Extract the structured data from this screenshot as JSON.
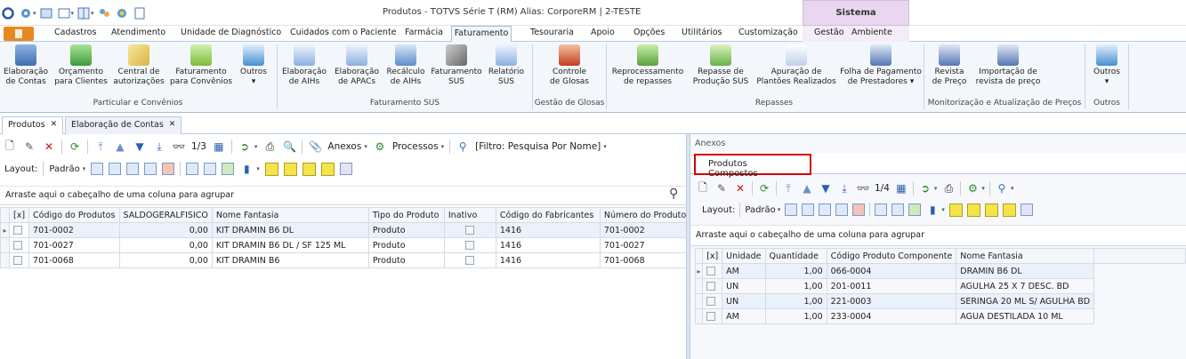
{
  "window_title": "Produtos - TOTVS Série T  (RM) Alias: CorporeRM | 2-TESTE",
  "context_tab": "Sistema",
  "menu_tabs": [
    "Cadastros",
    "Atendimento",
    "Unidade de Diagnóstico",
    "Cuidados com o Paciente",
    "Farmácia",
    "Faturamento",
    "Tesouraria",
    "Apoio",
    "Opções",
    "Utilitários",
    "Customização",
    "Gestão",
    "Ambiente"
  ],
  "active_menu_tab": "Faturamento",
  "ribbon": {
    "buttons": [
      {
        "l1": "Elaboração",
        "l2": "de Contas"
      },
      {
        "l1": "Orçamento",
        "l2": "para Clientes"
      },
      {
        "l1": "Central de",
        "l2": "autorizações"
      },
      {
        "l1": "Faturamento",
        "l2": "para Convênios"
      },
      {
        "l1": "Outros",
        "l2": "▾"
      },
      {
        "l1": "Elaboração",
        "l2": "de AIHs"
      },
      {
        "l1": "Elaboração",
        "l2": "de APACs"
      },
      {
        "l1": "Recálculo",
        "l2": "de AIHs"
      },
      {
        "l1": "Faturamento",
        "l2": "SUS"
      },
      {
        "l1": "Relatório",
        "l2": "SUS"
      },
      {
        "l1": "Controle",
        "l2": "de Glosas"
      },
      {
        "l1": "Reprocessamento",
        "l2": "de repasses"
      },
      {
        "l1": "Repasse de",
        "l2": "Produção SUS"
      },
      {
        "l1": "Apuração de",
        "l2": "Plantões Realizados"
      },
      {
        "l1": "Folha de Pagamento",
        "l2": "de Prestadores ▾"
      },
      {
        "l1": "Revista",
        "l2": "de Preço"
      },
      {
        "l1": "Importação de",
        "l2": "revista de preço"
      },
      {
        "l1": "Outros",
        "l2": "▾"
      }
    ],
    "groups": [
      "Particular e Convênios",
      "Faturamento SUS",
      "Gestão de Glosas",
      "Repasses",
      "Monitorização e Atualização de Preços",
      "Outros"
    ]
  },
  "doc_tabs": [
    "Produtos",
    "Elaboração de Contas"
  ],
  "toolbar": {
    "page": "1/3",
    "anexos": "Anexos",
    "processos": "Processos",
    "filtro": "[Filtro: Pesquisa Por Nome]",
    "layout": "Layout:",
    "padrao": "Padrão"
  },
  "group_hint": "Arraste aqui o cabeçalho de uma coluna para agrupar",
  "left_table": {
    "columns": [
      "[x]",
      "Código do Produtos",
      "SALDOGERALFISICO",
      "Nome Fantasia",
      "Tipo do Produto",
      "Inativo",
      "Código do Fabricantes",
      "Número do Produto"
    ],
    "rows": [
      [
        "701-0002",
        "0,00",
        "KIT DRAMIN B6 DL",
        "Produto",
        "1416",
        "701-0002"
      ],
      [
        "701-0027",
        "0,00",
        "KIT DRAMIN B6 DL / SF 125 ML",
        "Produto",
        "1416",
        "701-0027"
      ],
      [
        "701-0068",
        "0,00",
        "KIT DRAMIN B6",
        "Produto",
        "1416",
        "701-0068"
      ]
    ]
  },
  "right_panel": {
    "title": "Anexos",
    "subtab": "Produtos Compostos",
    "page": "1/4",
    "columns": [
      "[x]",
      "Unidade",
      "Quantidade",
      "Código Produto Componente",
      "Nome Fantasia"
    ],
    "rows": [
      [
        "AM",
        "1,00",
        "066-0004",
        "DRAMIN B6 DL"
      ],
      [
        "UN",
        "1,00",
        "201-0011",
        "AGULHA 25 X 7 DESC. BD"
      ],
      [
        "UN",
        "1,00",
        "221-0003",
        "SERINGA 20 ML S/ AGULHA BD"
      ],
      [
        "AM",
        "1,00",
        "233-0004",
        "AGUA DESTILADA 10 ML"
      ]
    ]
  }
}
